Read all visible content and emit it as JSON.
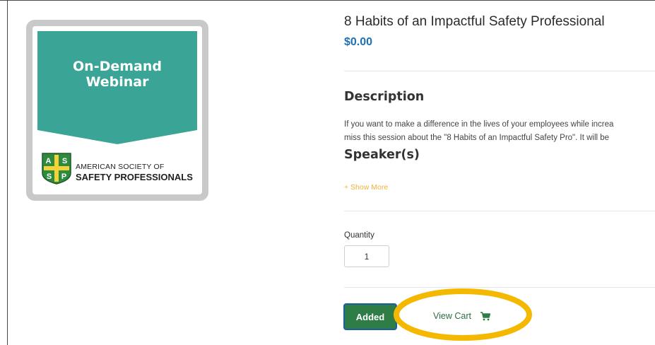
{
  "product": {
    "title": "8 Habits of an Impactful Safety Professional",
    "price": "$0.00"
  },
  "image": {
    "banner_line1": "On-Demand",
    "banner_line2": "Webinar",
    "org_line1": "AMERICAN SOCIETY OF",
    "org_line2": "SAFETY PROFESSIONALS",
    "logo_letters": [
      "A",
      "S",
      "S",
      "P"
    ],
    "banner_color": "#3aa596",
    "logo_color": "#2e8b3e"
  },
  "description": {
    "heading": "Description",
    "line1": "If you want to make a difference in the lives of your employees while increa",
    "line2": "miss this session about the \"8 Habits of an Impactful Safety Pro\". It will be"
  },
  "speakers": {
    "heading": "Speaker(s)",
    "show_more": "+ Show More"
  },
  "quantity": {
    "label": "Quantity",
    "value": "1"
  },
  "actions": {
    "added_label": "Added",
    "view_cart_label": "View Cart",
    "cart_icon": "shopping-cart-icon"
  },
  "colors": {
    "price": "#1f6fb4",
    "show_more": "#f0b33c",
    "button": "#2e7d46",
    "highlight": "#f5b800"
  }
}
